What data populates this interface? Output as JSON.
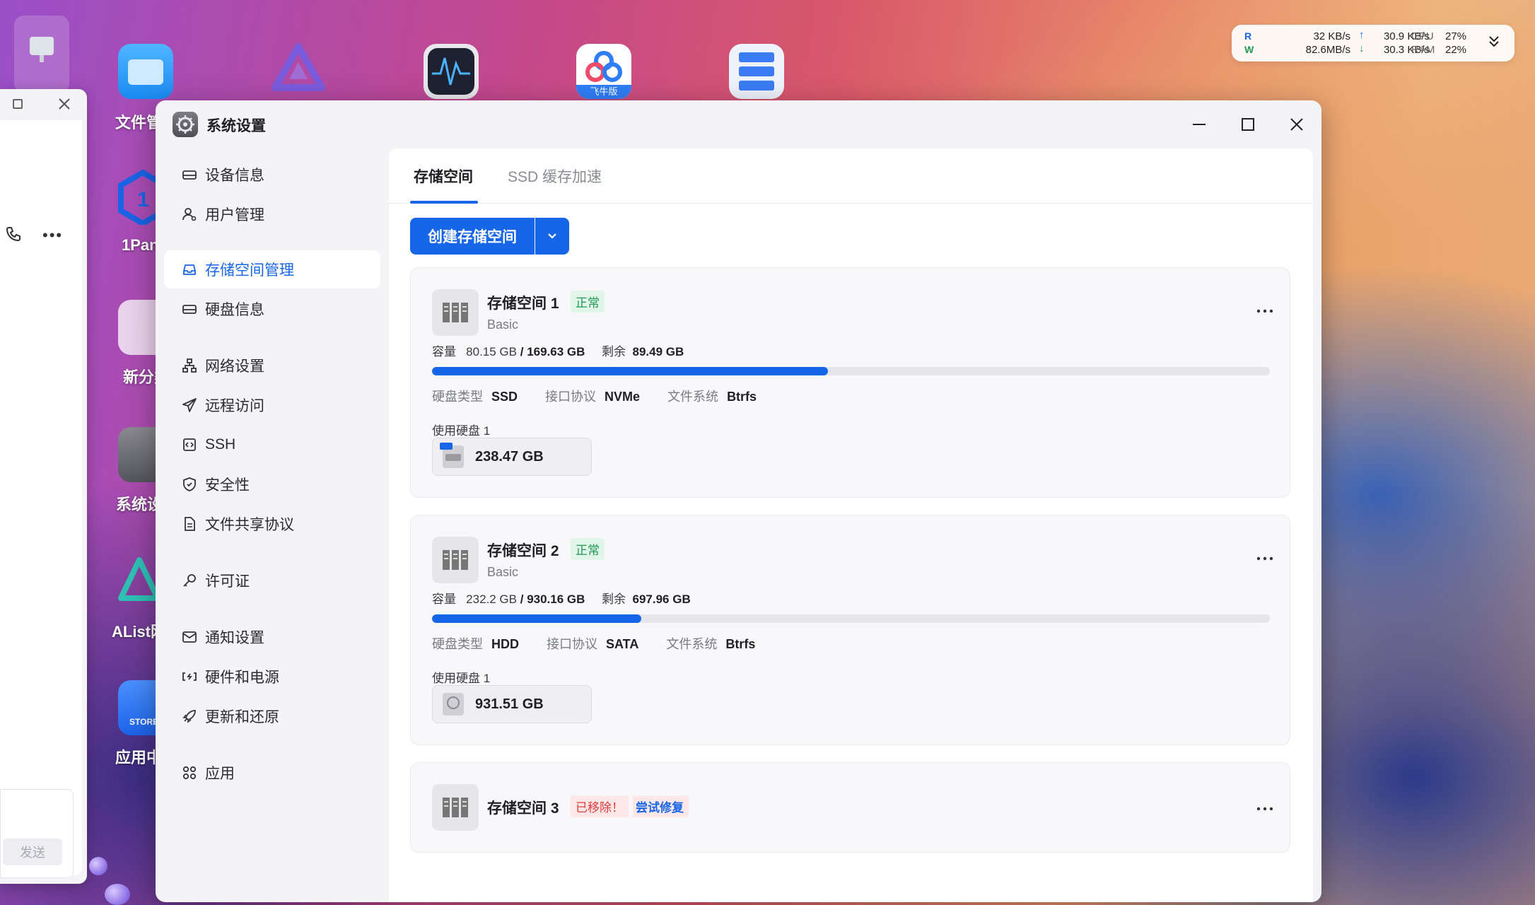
{
  "desktop": {
    "labels": [
      "文件管",
      "1Pan",
      "新分类",
      "系统设",
      "AList网",
      "应用中"
    ],
    "feiniu_badge": "飞牛版",
    "store_label": "STORE"
  },
  "chat_window": {
    "send_label": "发送"
  },
  "monitor": {
    "r_label": "R",
    "w_label": "W",
    "disk_read": "32 KB/s",
    "disk_write": "82.6MB/s",
    "net_up": "30.9 KB/s",
    "net_down": "30.3 KB/s",
    "cpu_label": "CPU",
    "ram_label": "RAM",
    "cpu_value": "27%",
    "ram_value": "22%"
  },
  "window": {
    "title": "系统设置"
  },
  "sidebar": {
    "items": [
      {
        "label": "设备信息",
        "icon": "device-icon"
      },
      {
        "label": "用户管理",
        "icon": "user-icon"
      },
      {
        "label": "存储空间管理",
        "icon": "storage-icon",
        "active": true
      },
      {
        "label": "硬盘信息",
        "icon": "disk-icon"
      },
      {
        "label": "网络设置",
        "icon": "network-icon"
      },
      {
        "label": "远程访问",
        "icon": "send-icon"
      },
      {
        "label": "SSH",
        "icon": "code-icon"
      },
      {
        "label": "安全性",
        "icon": "shield-icon"
      },
      {
        "label": "文件共享协议",
        "icon": "document-icon"
      },
      {
        "label": "许可证",
        "icon": "key-icon"
      },
      {
        "label": "通知设置",
        "icon": "mail-icon"
      },
      {
        "label": "硬件和电源",
        "icon": "battery-icon"
      },
      {
        "label": "更新和还原",
        "icon": "rocket-icon"
      },
      {
        "label": "应用",
        "icon": "apps-icon"
      }
    ]
  },
  "tabs": [
    {
      "label": "存储空间",
      "active": true
    },
    {
      "label": "SSD 缓存加速",
      "active": false
    }
  ],
  "toolbar": {
    "create_label": "创建存储空间"
  },
  "pools": [
    {
      "name": "存储空间 1",
      "status": "正常",
      "raid": "Basic",
      "capacity_label": "容量",
      "used": "80.15 GB",
      "total": "169.63 GB",
      "remaining_label": "剩余",
      "remaining": "89.49 GB",
      "usage_percent": 47.25,
      "disk_type_label": "硬盘类型",
      "disk_type": "SSD",
      "interface_label": "接口协议",
      "interface": "NVMe",
      "fs_label": "文件系统",
      "fs": "Btrfs",
      "disks_label": "使用硬盘 1",
      "disk_size": "238.47 GB",
      "disk_icon": "ssd-os-icon"
    },
    {
      "name": "存储空间 2",
      "status": "正常",
      "raid": "Basic",
      "capacity_label": "容量",
      "used": "232.2 GB",
      "total": "930.16 GB",
      "remaining_label": "剩余",
      "remaining": "697.96 GB",
      "usage_percent": 24.96,
      "disk_type_label": "硬盘类型",
      "disk_type": "HDD",
      "interface_label": "接口协议",
      "interface": "SATA",
      "fs_label": "文件系统",
      "fs": "Btrfs",
      "disks_label": "使用硬盘 1",
      "disk_size": "931.51 GB",
      "disk_icon": "hdd-icon"
    },
    {
      "name": "存储空间 3",
      "status_removed": "已移除！",
      "repair_label": "尝试修复"
    }
  ],
  "colors": {
    "accent": "#1766e8",
    "ok": "#1f9a55",
    "error": "#e23b3b"
  }
}
